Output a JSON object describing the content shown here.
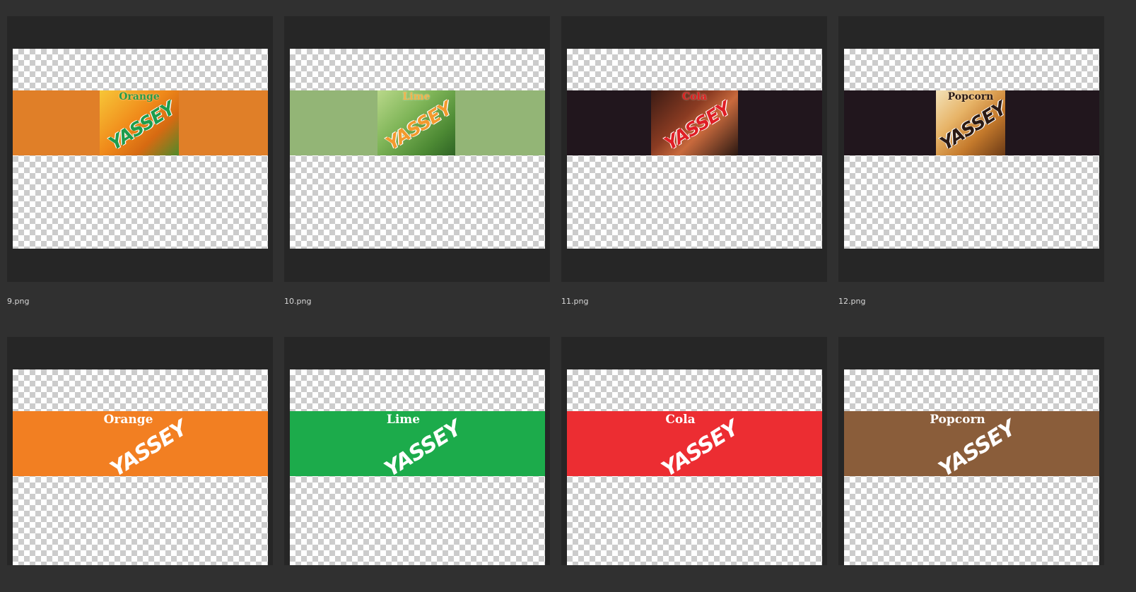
{
  "files": [
    {
      "name": "9.png",
      "flavor": "Orange",
      "logo": "YASSEY",
      "style": "photo",
      "band_color": "#e07f28",
      "art_bg": "linear-gradient(135deg,#f7c638 0%,#f08a1a 45%,#d66a12 70%,#4f8a2a 100%)",
      "flavor_color": "#2a9b46",
      "logo_color": "#1e9c4c"
    },
    {
      "name": "10.png",
      "flavor": "Lime",
      "logo": "YASSEY",
      "style": "photo",
      "band_color": "#93b576",
      "art_bg": "linear-gradient(135deg,#b9d88a 0%,#7fb558 40%,#4d8a34 75%,#2f6425 100%)",
      "flavor_color": "#f2b24b",
      "logo_color": "#f39a2e"
    },
    {
      "name": "11.png",
      "flavor": "Cola",
      "logo": "YASSEY",
      "style": "photo",
      "band_color": "#21161d",
      "art_bg": "linear-gradient(135deg,#3a1b14 0%,#8a3b22 40%,#c96a3d 60%,#2a1812 100%)",
      "flavor_color": "#e02020",
      "logo_color": "#e01f26"
    },
    {
      "name": "12.png",
      "flavor": "Popcorn",
      "logo": "YASSEY",
      "style": "photo",
      "band_color": "#21161d",
      "art_bg": "linear-gradient(135deg,#f3e2b8 0%,#e7b468 35%,#c57a2c 65%,#6b3a16 100%)",
      "flavor_color": "#2b1a14",
      "logo_color": "#2b1a14"
    },
    {
      "name": "",
      "flavor": "Orange",
      "logo": "YASSEY",
      "style": "flat",
      "band_color": "#f27f22",
      "flavor_color": "#ffffff",
      "logo_color": "#ffffff"
    },
    {
      "name": "",
      "flavor": "Lime",
      "logo": "YASSEY",
      "style": "flat",
      "band_color": "#1cab4b",
      "flavor_color": "#ffffff",
      "logo_color": "#ffffff"
    },
    {
      "name": "",
      "flavor": "Cola",
      "logo": "YASSEY",
      "style": "flat",
      "band_color": "#ec2d32",
      "flavor_color": "#ffffff",
      "logo_color": "#ffffff"
    },
    {
      "name": "",
      "flavor": "Popcorn",
      "logo": "YASSEY",
      "style": "flat",
      "band_color": "#8a5d3a",
      "flavor_color": "#ffffff",
      "logo_color": "#ffffff"
    }
  ]
}
